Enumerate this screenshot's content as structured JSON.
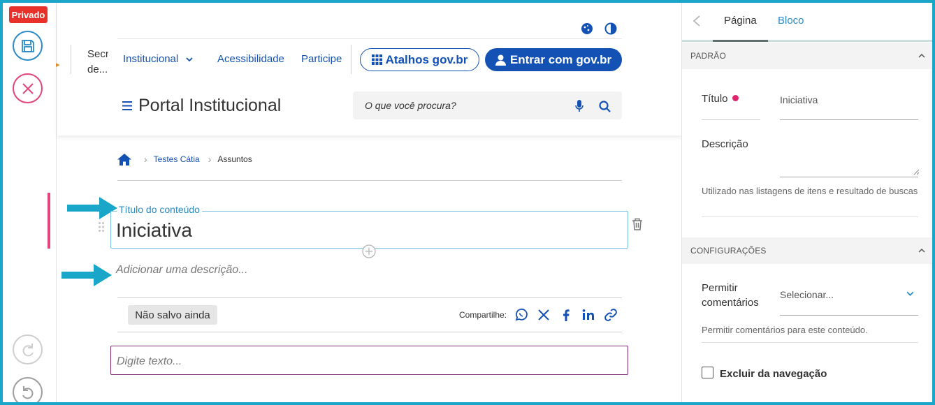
{
  "toolbar": {
    "badge": "Privado"
  },
  "header": {
    "org_name": "Secr... de...",
    "nav": [
      "Institucional",
      "Acessibilidade",
      "Participe"
    ],
    "shortcuts_button": "Atalhos gov.br",
    "login_button": "Entrar com gov.br",
    "portal_title": "Portal Institucional",
    "search_placeholder": "O que você procura?"
  },
  "breadcrumb": {
    "items": [
      "Testes Cátia",
      "Assuntos"
    ]
  },
  "editor": {
    "title_legend": "Título do conteúdo",
    "title_value": "Iniciativa",
    "description_placeholder": "Adicionar uma descrição...",
    "status": "Não salvo ainda",
    "share_label": "Compartilhe:",
    "text_placeholder": "Digite texto..."
  },
  "sidebar": {
    "tabs": [
      "Página",
      "Bloco"
    ],
    "section_default": "PADRÃO",
    "title_label": "Título",
    "title_value": "Iniciativa",
    "description_label": "Descrição",
    "description_help": "Utilizado nas listagens de itens e resultado de buscas",
    "section_settings": "CONFIGURAÇÕES",
    "comments_label": "Permitir comentários",
    "comments_select": "Selecionar...",
    "comments_help": "Permitir comentários para este conteúdo.",
    "exclude_nav_label": "Excluir da navegação"
  },
  "colors": {
    "gov_blue": "#1351b4",
    "accent_cyan": "#19a6c9",
    "danger_red": "#e8312a",
    "pink_accent": "#e0457b"
  }
}
